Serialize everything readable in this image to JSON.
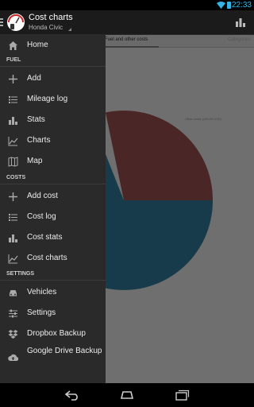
{
  "status_bar": {
    "time": "22:33"
  },
  "action_bar": {
    "title": "Cost charts",
    "subtitle": "Honda Civic"
  },
  "content": {
    "tabs": [
      "Fuel and other costs",
      "Categories"
    ],
    "legend_label": "Other costs (100.00 USD)"
  },
  "drawer": {
    "home": "Home",
    "fuel_section": "FUEL",
    "fuel_items": [
      "Add",
      "Mileage log",
      "Stats",
      "Charts",
      "Map"
    ],
    "costs_section": "COSTS",
    "cost_items": [
      "Add cost",
      "Cost log",
      "Cost stats",
      "Cost charts"
    ],
    "settings_section": "SETTINGS",
    "settings_items": [
      "Vehicles",
      "Settings",
      "Dropbox Backup",
      "Google Drive Backup"
    ]
  },
  "colors": {
    "accent": "#33b5e5",
    "pie_red": "#4b2626",
    "pie_teal": "#173b4a"
  }
}
